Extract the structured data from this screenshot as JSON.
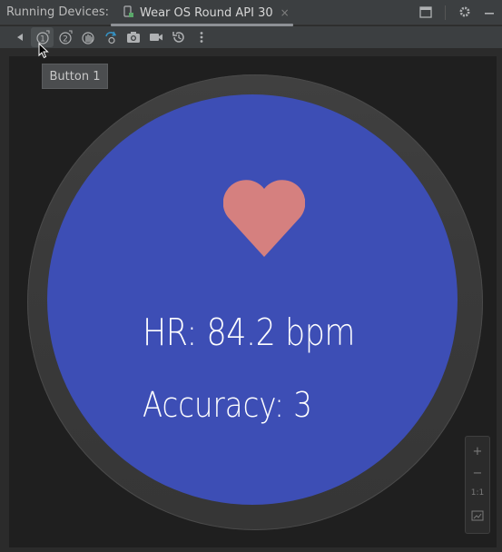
{
  "header": {
    "label": "Running Devices:",
    "tab_label": "Wear OS Round API 30",
    "tab_close": "×"
  },
  "toolbar": {
    "items": [
      "back",
      "button-1",
      "button-2",
      "palm",
      "rotate",
      "screenshot",
      "record",
      "reset",
      "more"
    ]
  },
  "tooltip": {
    "text": "Button 1"
  },
  "watch": {
    "heart_rate": "HR: 84.2 bpm",
    "accuracy": "Accuracy: 3",
    "screen_color": "#3d4eb5",
    "heart_color": "#d5807f"
  },
  "zoom": {
    "zoom_in": "+",
    "zoom_out": "−",
    "actual_size": "1:1"
  }
}
